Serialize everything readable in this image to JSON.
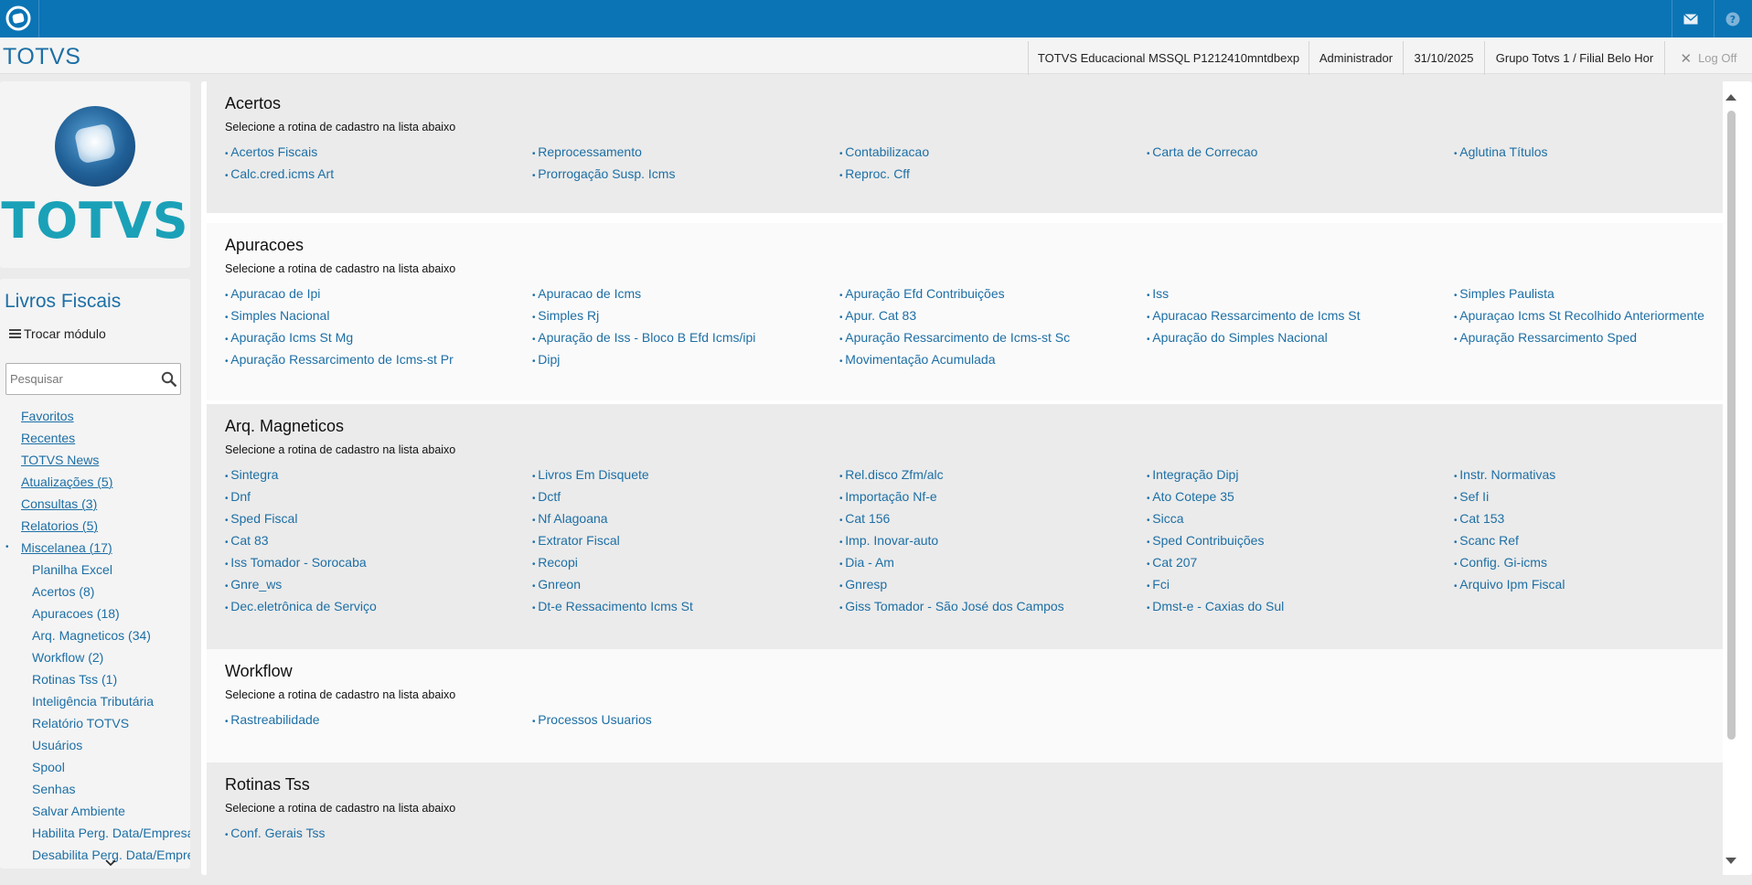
{
  "topbar": {
    "colors": {
      "bar": "#0a74b5"
    },
    "icons": [
      "totvs-logo-icon",
      "mail-icon",
      "help-icon"
    ]
  },
  "header": {
    "brand": "TOTVS",
    "environment": "TOTVS Educacional MSSQL P1212410mntdbexp",
    "user": "Administrador",
    "date": "31/10/2025",
    "branch": "Grupo Totvs 1 / Filial Belo Hor",
    "logoff": "Log Off"
  },
  "sidebar": {
    "logo_text": "TOTVS",
    "module_title": "Livros Fiscais",
    "switch_module": "Trocar módulo",
    "search_placeholder": "Pesquisar",
    "items": [
      {
        "label": "Favoritos",
        "level": 0
      },
      {
        "label": "Recentes",
        "level": 0
      },
      {
        "label": "TOTVS News",
        "level": 0
      },
      {
        "label": "Atualizações (5)",
        "level": 0
      },
      {
        "label": "Consultas (3)",
        "level": 0
      },
      {
        "label": "Relatorios (5)",
        "level": 0
      },
      {
        "label": "Miscelanea (17)",
        "level": 0,
        "expanded": true
      },
      {
        "label": "Planilha Excel",
        "level": 1
      },
      {
        "label": "Acertos (8)",
        "level": 1
      },
      {
        "label": "Apuracoes (18)",
        "level": 1
      },
      {
        "label": "Arq. Magneticos (34)",
        "level": 1
      },
      {
        "label": "Workflow (2)",
        "level": 1
      },
      {
        "label": "Rotinas Tss (1)",
        "level": 1
      },
      {
        "label": "Inteligência Tributária",
        "level": 1
      },
      {
        "label": "Relatório TOTVS",
        "level": 1
      },
      {
        "label": "Usuários",
        "level": 1
      },
      {
        "label": "Spool",
        "level": 1
      },
      {
        "label": "Senhas",
        "level": 1
      },
      {
        "label": "Salvar Ambiente",
        "level": 1
      },
      {
        "label": "Habilita Perg. Data/Empresa",
        "level": 1
      },
      {
        "label": "Desabilita Perg. Data/Empresa",
        "level": 1
      }
    ]
  },
  "sections": [
    {
      "title": "Acertos",
      "subtitle": "Selecione a rotina de cadastro na lista abaixo",
      "items": [
        "Acertos Fiscais",
        "Reprocessamento",
        "Contabilizacao",
        "Carta de Correcao",
        "Aglutina Títulos",
        "Calc.cred.icms Art",
        "Prorrogação Susp. Icms",
        "Reproc. Cff"
      ]
    },
    {
      "title": "Apuracoes",
      "subtitle": "Selecione a rotina de cadastro na lista abaixo",
      "items": [
        "Apuracao de Ipi",
        "Apuracao de Icms",
        "Apuração Efd Contribuições",
        "Iss",
        "Simples Paulista",
        "Simples Nacional",
        "Simples Rj",
        "Apur. Cat 83",
        "Apuracao Ressarcimento de Icms St",
        "Apuraçao Icms St Recolhido Anteriormente",
        "Apuração Icms St Mg",
        "Apuração de Iss - Bloco B Efd Icms/ipi",
        "Apuração Ressarcimento de Icms-st Sc",
        "Apuração do Simples Nacional",
        "Apuração Ressarcimento Sped",
        "Apuração Ressarcimento de Icms-st Pr",
        "Dipj",
        "Movimentação Acumulada"
      ]
    },
    {
      "title": "Arq. Magneticos",
      "subtitle": "Selecione a rotina de cadastro na lista abaixo",
      "items": [
        "Sintegra",
        "Livros Em Disquete",
        "Rel.disco Zfm/alc",
        "Integração Dipj",
        "Instr. Normativas",
        "Dnf",
        "Dctf",
        "Importação Nf-e",
        "Ato Cotepe 35",
        "Sef Ii",
        "Sped Fiscal",
        "Nf Alagoana",
        "Cat 156",
        "Sicca",
        "Cat 153",
        "Cat 83",
        "Extrator Fiscal",
        "Imp. Inovar-auto",
        "Sped Contribuições",
        "Scanc Ref",
        "Iss Tomador - Sorocaba",
        "Recopi",
        "Dia - Am",
        "Cat 207",
        "Config. Gi-icms",
        "Gnre_ws",
        "Gnreon",
        "Gnresp",
        "Fci",
        "Arquivo Ipm Fiscal",
        "Dec.eletrônica de Serviço",
        "Dt-e Ressacimento Icms St",
        "Giss Tomador - São José dos Campos",
        "Dmst-e - Caxias do Sul"
      ]
    },
    {
      "title": "Workflow",
      "subtitle": "Selecione a rotina de cadastro na lista abaixo",
      "items": [
        "Rastreabilidade",
        "Processos Usuarios"
      ]
    },
    {
      "title": "Rotinas Tss",
      "subtitle": "Selecione a rotina de cadastro na lista abaixo",
      "items": [
        "Conf. Gerais Tss"
      ]
    }
  ]
}
